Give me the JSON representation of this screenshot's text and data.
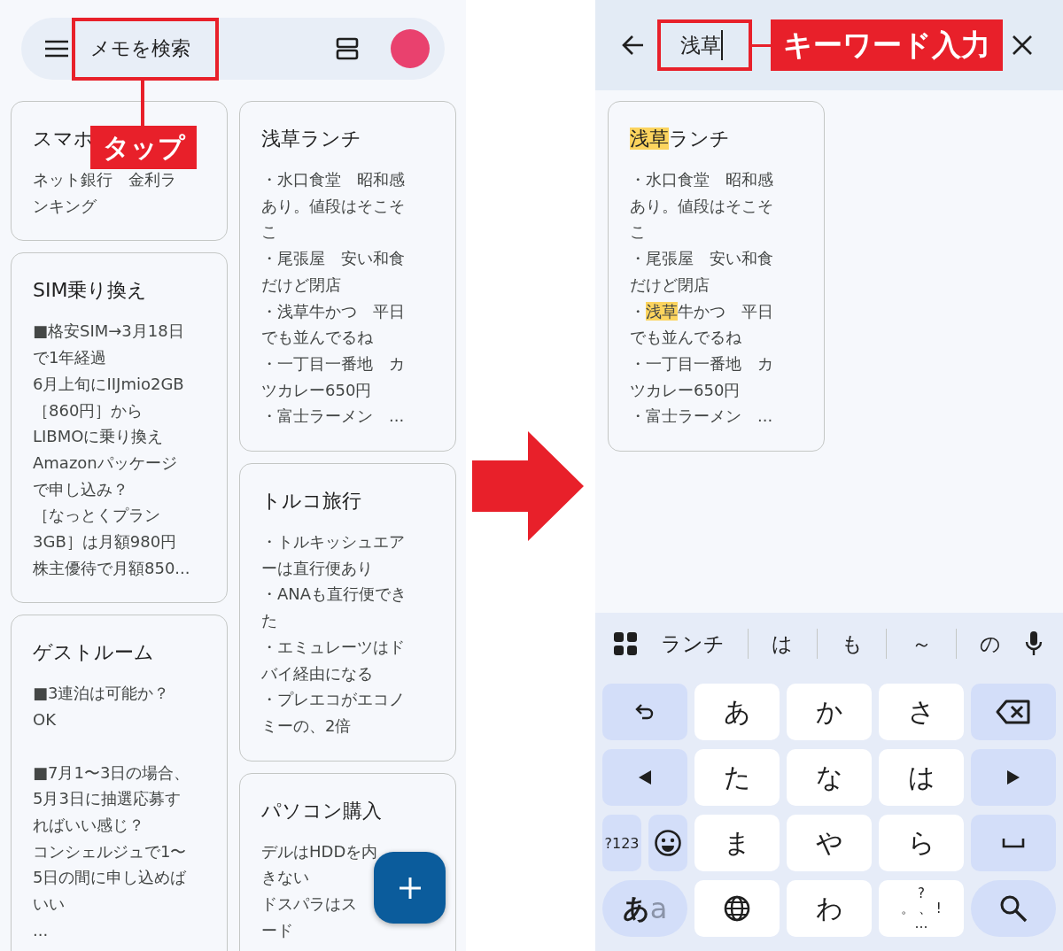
{
  "left_screen": {
    "search": {
      "placeholder": "メモを検索"
    },
    "annotation": {
      "label": "タップ"
    },
    "columns": [
      [
        {
          "title": "スマホ",
          "body": [
            "ネット銀行　金利ラ",
            "ンキング"
          ]
        },
        {
          "title": "SIM乗り換え",
          "body": [
            "■格安SIM→3月18日",
            "で1年経過",
            "6月上旬にIIJmio2GB",
            "［860円］から",
            "LIBMOに乗り換え",
            "Amazonパッケージ",
            "で申し込み？",
            "［なっとくプラン",
            "3GB］は月額980円",
            "株主優待で月額850..."
          ]
        },
        {
          "title": "ゲストルーム",
          "body": [
            "■3連泊は可能か？",
            "OK"
          ],
          "body_2": [
            "■7月1〜3日の場合、",
            "5月3日に抽選応募す",
            "ればいい感じ？",
            "コンシェルジュで1〜",
            "5日の間に申し込めば",
            "いい",
            "..."
          ]
        }
      ],
      [
        {
          "title": "浅草ランチ",
          "body": [
            "・水口食堂　昭和感",
            "あり。値段はそこそ",
            "こ",
            "・尾張屋　安い和食",
            "だけど閉店",
            "・浅草牛かつ　平日",
            "でも並んでるね",
            "・一丁目一番地　カ",
            "ツカレー650円",
            "・富士ラーメン　..."
          ]
        },
        {
          "title": "トルコ旅行",
          "body": [
            "・トルキッシュエア",
            "ーは直行便あり",
            "・ANAも直行便でき",
            "た",
            "・エミュレーツはド",
            "バイ経由になる",
            "・プレエコがエコノ",
            "ミーの、2倍"
          ]
        },
        {
          "title": "パソコン購入",
          "body": [
            "デルはHDDを内",
            "きない",
            "ドスパラはス",
            "ード"
          ]
        }
      ]
    ]
  },
  "right_screen": {
    "search": {
      "value": "浅草"
    },
    "annotation": {
      "label": "キーワード入力"
    },
    "result": {
      "title": [
        {
          "text": "浅草",
          "highlighted": true
        },
        {
          "text": "ランチ",
          "highlighted": false
        }
      ],
      "body": [
        [
          {
            "text": "・水口食堂　昭和感",
            "highlighted": false
          }
        ],
        [
          {
            "text": "あり。値段はそこそ",
            "highlighted": false
          }
        ],
        [
          {
            "text": "こ",
            "highlighted": false
          }
        ],
        [
          {
            "text": "・尾張屋　安い和食",
            "highlighted": false
          }
        ],
        [
          {
            "text": "だけど閉店",
            "highlighted": false
          }
        ],
        [
          {
            "text": "・",
            "highlighted": false
          },
          {
            "text": "浅草",
            "highlighted": true
          },
          {
            "text": "牛かつ　平日",
            "highlighted": false
          }
        ],
        [
          {
            "text": "でも並んでるね",
            "highlighted": false
          }
        ],
        [
          {
            "text": "・一丁目一番地　カ",
            "highlighted": false
          }
        ],
        [
          {
            "text": "ツカレー650円",
            "highlighted": false
          }
        ],
        [
          {
            "text": "・富士ラーメン　...",
            "highlighted": false
          }
        ]
      ]
    },
    "keyboard": {
      "suggestions": [
        "ランチ",
        "は",
        "も",
        "～",
        "の"
      ],
      "rows": [
        [
          {
            "kind": "undo"
          },
          {
            "kind": "char",
            "label": "あ"
          },
          {
            "kind": "char",
            "label": "か"
          },
          {
            "kind": "char",
            "label": "さ"
          },
          {
            "kind": "backspace"
          }
        ],
        [
          {
            "kind": "left"
          },
          {
            "kind": "char",
            "label": "た"
          },
          {
            "kind": "char",
            "label": "な"
          },
          {
            "kind": "char",
            "label": "は"
          },
          {
            "kind": "right"
          }
        ],
        [
          {
            "kind": "pair",
            "keys": [
              {
                "kind": "symbols",
                "label": "?123"
              },
              {
                "kind": "emoji"
              }
            ]
          },
          {
            "kind": "char",
            "label": "ま"
          },
          {
            "kind": "char",
            "label": "や"
          },
          {
            "kind": "char",
            "label": "ら"
          },
          {
            "kind": "space"
          }
        ],
        [
          {
            "kind": "mode",
            "label": "あ",
            "secondary": "a"
          },
          {
            "kind": "globe"
          },
          {
            "kind": "char",
            "label": "わ"
          },
          {
            "kind": "punct",
            "lines": [
              "?",
              "。 、 !",
              "…"
            ]
          },
          {
            "kind": "search"
          }
        ]
      ]
    }
  }
}
